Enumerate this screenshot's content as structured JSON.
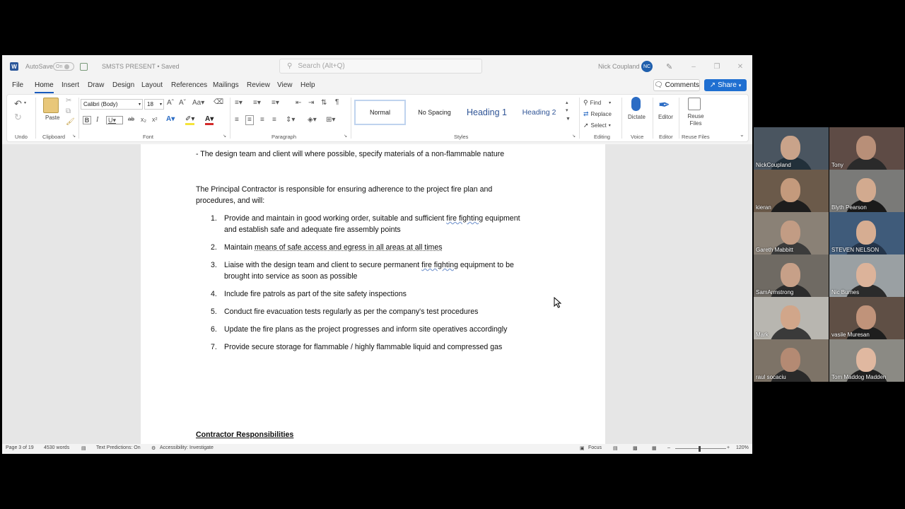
{
  "titlebar": {
    "app_icon": "W",
    "autosave_label": "AutoSave",
    "autosave_state": "On",
    "doc_title": "SMSTS PRESENT • Saved",
    "search_placeholder": "Search (Alt+Q)",
    "user_name": "Nick Coupland",
    "user_initials": "NC"
  },
  "tabs": [
    "File",
    "Home",
    "Insert",
    "Draw",
    "Design",
    "Layout",
    "References",
    "Mailings",
    "Review",
    "View",
    "Help"
  ],
  "active_tab": "Home",
  "actions": {
    "comments": "Comments",
    "share": "Share"
  },
  "ribbon": {
    "undo_label": "Undo",
    "clipboard_label": "Clipboard",
    "paste_label": "Paste",
    "font_label": "Font",
    "font_name": "Calibri (Body)",
    "font_size": "18",
    "paragraph_label": "Paragraph",
    "styles_label": "Styles",
    "styles": [
      "Normal",
      "No Spacing",
      "Heading 1",
      "Heading 2"
    ],
    "find": "Find",
    "replace": "Replace",
    "select": "Select",
    "editing_label": "Editing",
    "dictate": "Dictate",
    "voice_label": "Voice",
    "editor": "Editor",
    "editor_label": "Editor",
    "reuse_files": "Reuse Files",
    "reuse_label": "Reuse Files",
    "accent_color": "#185abd"
  },
  "document": {
    "line1": "- The design team and client will where possible, specify materials of a non-flammable nature",
    "intro_line1": "The Principal Contractor is responsible for ensuring adherence to the project fire plan and",
    "intro_line2": "procedures, and will:",
    "items": [
      {
        "num": "1.",
        "l1a": "Provide and maintain in good working order, suitable and sufficient ",
        "l1b": "fire fighting",
        "l1c": " equipment",
        "l2": "and establish safe and adequate fire assembly points"
      },
      {
        "num": "2.",
        "pre": "Maintain ",
        "mid": "means of safe access and egress in all areas at all times"
      },
      {
        "num": "3.",
        "l1a": "Liaise with the design team and client to secure permanent ",
        "l1b": "fire fighting",
        "l1c": " equipment to be",
        "l2": "brought into service as soon as possible"
      },
      {
        "num": "4.",
        "text": "Include fire patrols as part of the site safety inspections"
      },
      {
        "num": "5.",
        "text": "Conduct fire evacuation tests regularly as per the company's test procedures"
      },
      {
        "num": "6.",
        "text": "Update the fire plans as the project progresses and inform site operatives accordingly"
      },
      {
        "num": "7.",
        "text": "Provide secure storage for flammable / highly flammable liquid and compressed gas"
      }
    ],
    "next_heading": "Contractor Responsibilities"
  },
  "statusbar": {
    "page": "Page 3 of 19",
    "words": "4530 words",
    "text_predictions": "Text Predictions: On",
    "accessibility": "Accessibility: Investigate",
    "focus": "Focus",
    "zoom": "120%"
  },
  "participants": [
    {
      "name": "NickCoupland",
      "bg": "#4a5560",
      "skin": "#c9a38a",
      "shirt": "#22303a"
    },
    {
      "name": "Tony",
      "bg": "#5e4b45",
      "skin": "#b88f78",
      "shirt": "#2a2a2a"
    },
    {
      "name": "kieran",
      "bg": "#6b5a4a",
      "skin": "#c49a7c",
      "shirt": "#1d1d1d"
    },
    {
      "name": "Blyth Pearson",
      "bg": "#7a7a78",
      "skin": "#d2aa8f",
      "shirt": "#1a1a1a"
    },
    {
      "name": "Gareth Mabbitt",
      "bg": "#8a8176",
      "skin": "#c29c84",
      "shirt": "#3b3b3b"
    },
    {
      "name": "STEVEN NELSON",
      "bg": "#3f5b7a",
      "skin": "#d6ad92",
      "shirt": "#24354a"
    },
    {
      "name": "SamArmstrong",
      "bg": "#6f6a63",
      "skin": "#c7a088",
      "shirt": "#2c2c2c"
    },
    {
      "name": "Nic Burnes",
      "bg": "#9aa0a3",
      "skin": "#dcb39a",
      "shirt": "#2b2b2b"
    },
    {
      "name": "Mark",
      "bg": "#b8b6b0",
      "skin": "#d1a68a",
      "shirt": "#3a3a3a"
    },
    {
      "name": "vasile Muresan",
      "bg": "#5f4f45",
      "skin": "#c0937a",
      "shirt": "#1e1e1e"
    },
    {
      "name": "raul socaciu",
      "bg": "#7d7367",
      "skin": "#b48a73",
      "shirt": "#2a2a2a"
    },
    {
      "name": "Tom Maddog Madden",
      "bg": "#8b8a84",
      "skin": "#e0b8a0",
      "shirt": "#222222"
    }
  ]
}
